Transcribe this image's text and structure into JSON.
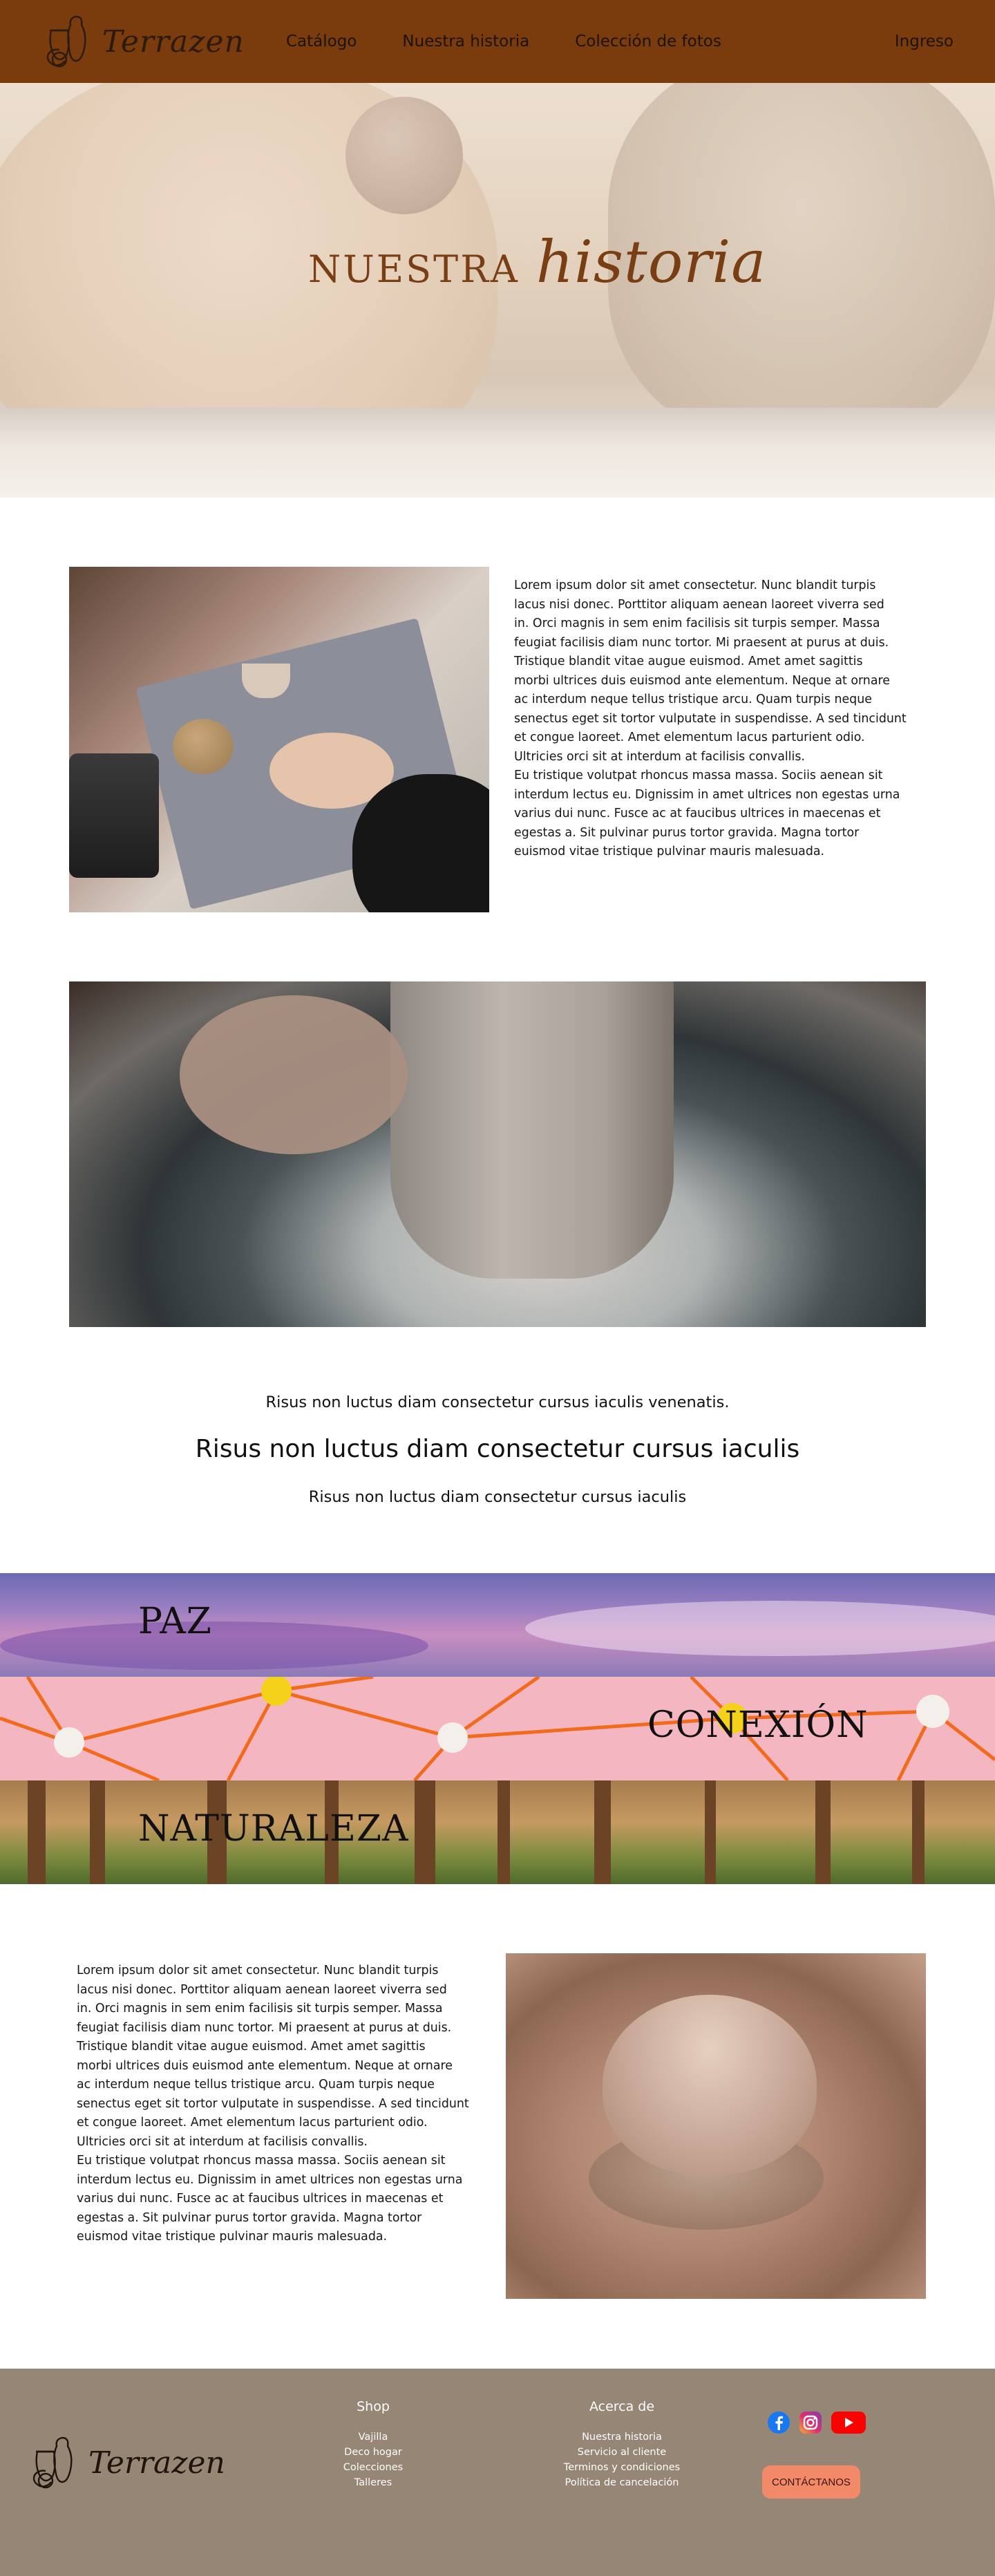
{
  "nav": {
    "brand": "Terrazen",
    "links": [
      "Catálogo",
      "Nuestra historia",
      "Colección de fotos"
    ],
    "login": "Ingreso",
    "background": "#7a3c0c"
  },
  "hero": {
    "title_word1": "NUESTRA",
    "title_word2": "historia",
    "title_color": "#7a3e14"
  },
  "section1": {
    "text": "Lorem ipsum dolor sit amet consectetur. Nunc blandit turpis\nlacus nisi donec. Porttitor aliquam aenean laoreet viverra sed\nin. Orci magnis in sem enim facilisis sit turpis semper. Massa\nfeugiat facilisis diam nunc tortor. Mi praesent at purus at duis.\nTristique blandit vitae augue euismod. Amet amet sagittis\nmorbi ultrices duis euismod ante elementum. Neque at ornare\nac interdum neque tellus tristique arcu. Quam turpis neque\nsenectus eget sit tortor vulputate in suspendisse. A sed tincidunt\net congue laoreet. Amet elementum lacus parturient odio.\nUltricies orci sit at interdum at facilisis convallis.\nEu tristique volutpat rhoncus massa massa. Sociis aenean sit\ninterdum lectus eu. Dignissim in amet ultrices non egestas urna\nvarius dui nunc. Fusce ac at faucibus ultrices in maecenas et\negestas a. Sit pulvinar purus tortor gravida. Magna tortor\neuismod vitae tristique pulvinar mauris malesuada."
  },
  "quote": {
    "line1": "Risus non luctus diam consectetur cursus iaculis venenatis.",
    "line2": "Risus non luctus diam consectetur cursus iaculis",
    "line3": "Risus non luctus diam consectetur cursus iaculis"
  },
  "bands": {
    "paz": "PAZ",
    "conexion": "CONEXIÓN",
    "naturaleza": "NATURALEZA"
  },
  "section3": {
    "text": "Lorem ipsum dolor sit amet consectetur. Nunc blandit turpis\nlacus nisi donec. Porttitor aliquam aenean laoreet viverra sed\nin. Orci magnis in sem enim facilisis sit turpis semper. Massa\nfeugiat facilisis diam nunc tortor. Mi praesent at purus at duis.\nTristique blandit vitae augue euismod. Amet amet sagittis\nmorbi ultrices duis euismod ante elementum. Neque at ornare\nac interdum neque tellus tristique arcu. Quam turpis neque\nsenectus eget sit tortor vulputate in suspendisse. A sed tincidunt\net congue laoreet. Amet elementum lacus parturient odio.\nUltricies orci sit at interdum at facilisis convallis.\nEu tristique volutpat rhoncus massa massa. Sociis aenean sit\ninterdum lectus eu. Dignissim in amet ultrices non egestas urna\nvarius dui nunc. Fusce ac at faucibus ultrices in maecenas et\negestas a. Sit pulvinar purus tortor gravida. Magna tortor\neuismod vitae tristique pulvinar mauris malesuada."
  },
  "footer": {
    "brand": "Terrazen",
    "shop_heading": "Shop",
    "shop_items": [
      "Vajilla",
      "Deco hogar",
      "Colecciones",
      "Talleres"
    ],
    "about_heading": "Acerca de",
    "about_items": [
      "Nuestra historia",
      "Servicio al cliente",
      "Terminos y condiciones",
      "Política de cancelación"
    ],
    "social_icons": [
      "facebook-icon",
      "instagram-icon",
      "youtube-icon"
    ],
    "contact_button": "CONTÁCTANOS",
    "background": "#958676",
    "button_color": "#f28a6a"
  }
}
